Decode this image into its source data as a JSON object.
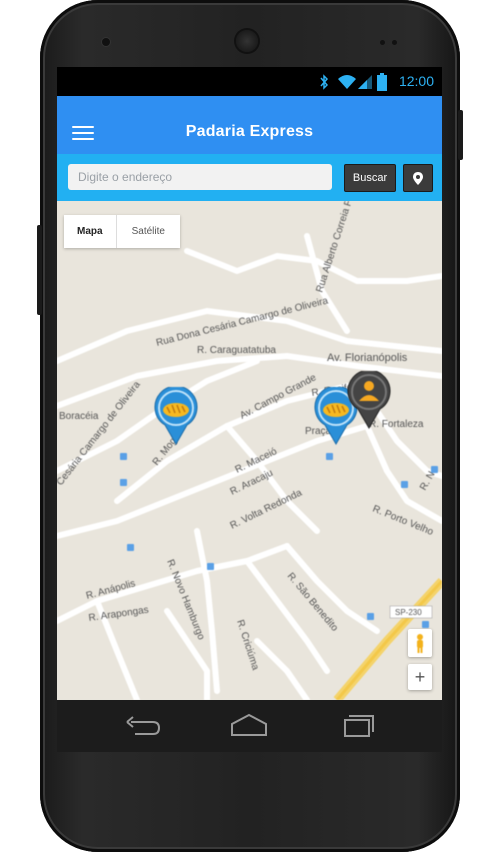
{
  "status_bar": {
    "time": "12:00",
    "icons": [
      "bluetooth-icon",
      "wifi-icon",
      "signal-icon",
      "battery-icon"
    ]
  },
  "app_bar": {
    "title": "Padaria Express",
    "menu_icon": "hamburger-menu-icon"
  },
  "search": {
    "placeholder": "Digite o endereço",
    "button_label": "Buscar",
    "location_icon": "map-pin-icon"
  },
  "map": {
    "type_toggle": {
      "map_label": "Mapa",
      "satellite_label": "Satélite",
      "selected": "Mapa"
    },
    "road_labels": [
      "Rua Alberto Correia Fra...",
      "Rua Dona Cesária Camargo de Oliveira",
      "R. Caraguatatuba",
      "Av. Florianópolis",
      "Av. Campo Grande",
      "R. Recife",
      "R. Fortaleza",
      "Boracéia",
      "Cesária Camargo de Oliveira",
      "R. Mogi",
      "R. Maceió",
      "R. Aracaju",
      "R. Volta Redonda",
      "R. Porto Velho",
      "R. Anápolis",
      "R. Arapongas",
      "R. Novo Hamburgo",
      "R. São Benedito",
      "R. Criciúma",
      "SP-230",
      "Praça",
      "R. N"
    ],
    "markers": [
      {
        "name": "bakery-marker",
        "icon": "bread-icon",
        "color": "#2a8fd8"
      },
      {
        "name": "bakery-marker",
        "icon": "bread-icon",
        "color": "#2a8fd8"
      },
      {
        "name": "user-location-marker",
        "icon": "person-icon",
        "color": "#444444"
      }
    ],
    "controls": {
      "pegman_icon": "pegman-icon",
      "zoom_in_label": "+"
    }
  },
  "nav_bar": {
    "buttons": [
      "back-icon",
      "home-icon",
      "recents-icon"
    ]
  }
}
